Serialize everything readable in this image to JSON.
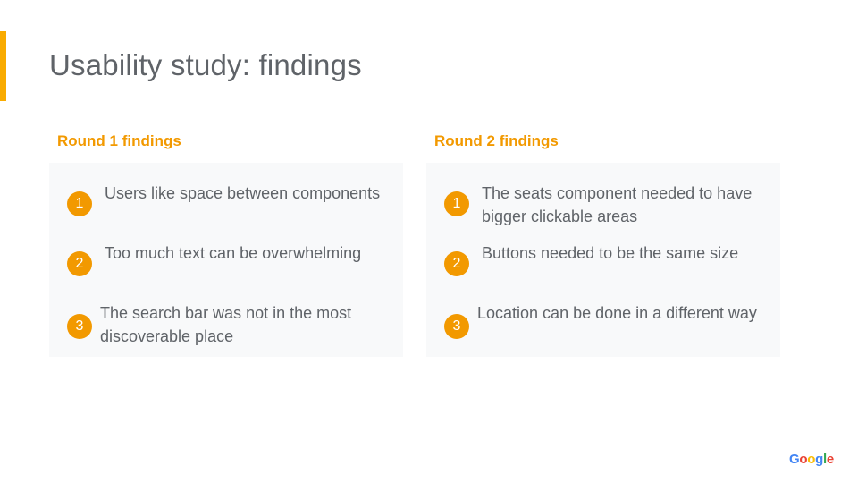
{
  "title": "Usability study: findings",
  "rounds": [
    {
      "heading": "Round 1 findings",
      "findings": [
        {
          "number": "1",
          "text": "Users like space between components"
        },
        {
          "number": "2",
          "text": "Too much text can be overwhelming"
        },
        {
          "number": "3",
          "text": "The search bar was not in the most discoverable place"
        }
      ]
    },
    {
      "heading": "Round 2 findings",
      "findings": [
        {
          "number": "1",
          "text": "The seats component needed to have bigger clickable areas"
        },
        {
          "number": "2",
          "text": "Buttons needed to be the same size"
        },
        {
          "number": "3",
          "text": "Location can be done in a different way"
        }
      ]
    }
  ],
  "logo": "Google",
  "colors": {
    "accent_bar": "#f9ab00",
    "heading": "#f29900",
    "badge": "#f29900",
    "panel": "#f8f9fa",
    "text": "#5f6368"
  }
}
